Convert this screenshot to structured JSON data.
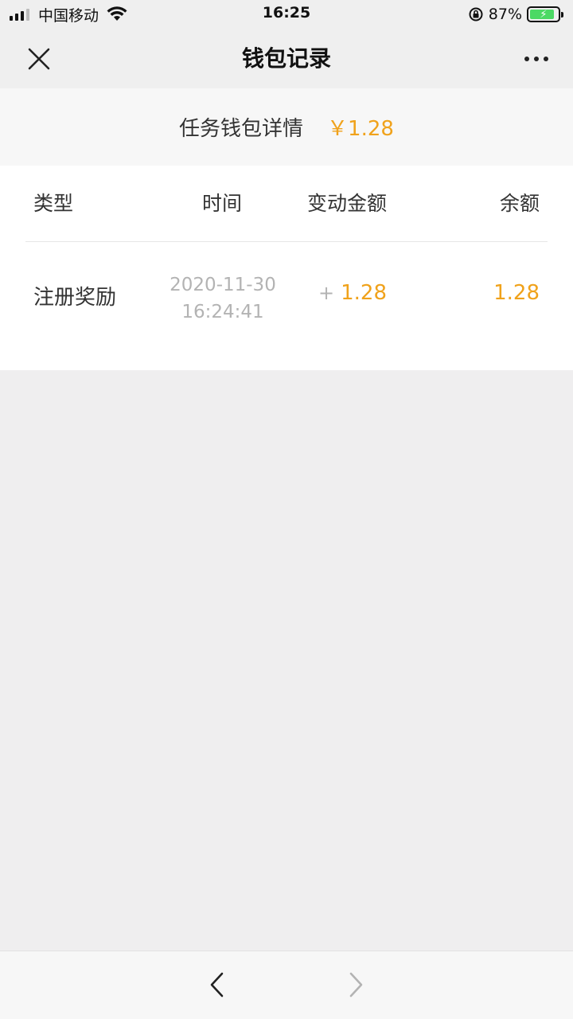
{
  "status_bar": {
    "carrier": "中国移动",
    "time": "16:25",
    "battery_percent": "87%",
    "battery_level": 0.87,
    "icons": [
      "signal-icon",
      "wifi-icon",
      "orientation-lock-icon",
      "battery-icon"
    ]
  },
  "nav": {
    "title": "钱包记录",
    "close_icon": "close-icon",
    "more_icon": "more-icon"
  },
  "summary": {
    "label": "任务钱包详情",
    "amount": "￥1.28"
  },
  "table": {
    "headers": {
      "type": "类型",
      "time": "时间",
      "change": "变动金额",
      "balance": "余额"
    },
    "rows": [
      {
        "type": "注册奖励",
        "date": "2020-11-30",
        "time": "16:24:41",
        "change_sign": "+",
        "change": "1.28",
        "balance": "1.28"
      }
    ]
  },
  "toolbar": {
    "back_icon": "chevron-left-icon",
    "forward_icon": "chevron-right-icon"
  },
  "colors": {
    "accent": "#f0a21b",
    "page_bg": "#efeeef",
    "muted": "#b3b3b3"
  }
}
